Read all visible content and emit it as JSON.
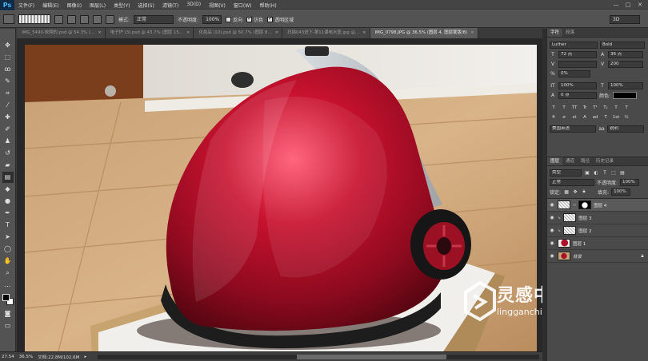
{
  "app": {
    "logo": "Ps"
  },
  "menu": [
    "文件(F)",
    "编辑(E)",
    "图像(I)",
    "图层(L)",
    "类型(Y)",
    "选择(S)",
    "滤镜(T)",
    "3D(D)",
    "视图(V)",
    "窗口(W)",
    "帮助(H)"
  ],
  "window_controls": [
    "—",
    "□",
    "✕"
  ],
  "options": {
    "mode_label": "模式:",
    "mode_value": "正常",
    "opacity_label": "不透明度:",
    "opacity_value": "100%",
    "reverse_label": "反向",
    "dither_label": "仿色",
    "transparency_label": "透明区域",
    "workspace": "3D"
  },
  "tabs": [
    {
      "label": "IMG_5490-依翔的.psd @ 54.3% (...",
      "active": false
    },
    {
      "label": "电子炉 (3).psd @ 43.7% (图层 15...",
      "active": false
    },
    {
      "label": "化妆品 (10).psd @ 50.7% (图层 8...",
      "active": false
    },
    {
      "label": "扫描043进下-第11课电水壶.jpg @...",
      "active": false
    },
    {
      "label": "IMG_0798.JPG @ 36.5% (图层 4, 图层蒙版/8)",
      "active": true
    }
  ],
  "status": {
    "coords": "27.54",
    "zoom": "36.5%",
    "doc": "文档:22.8M/102.6M"
  },
  "character_panel": {
    "tabs": [
      "字符",
      "段落"
    ],
    "font_family": "Luther",
    "font_style": "Bold",
    "font_size": "72 点",
    "leading": "36 点",
    "kerning": "",
    "tracking": "200",
    "scale_pct": "0%",
    "vertical_scale": "100%",
    "horizontal_scale": "100%",
    "baseline": "0 点",
    "color_label": "颜色:",
    "style_buttons": [
      "T",
      "T",
      "TT",
      "Tr",
      "T¹",
      "T₁",
      "T",
      "T"
    ],
    "opentype_buttons": [
      "fi",
      "σ",
      "st",
      "A",
      "ad",
      "T",
      "1st",
      "½"
    ],
    "language": "美国英语",
    "aa_icon": "aa",
    "antialias": "锐利"
  },
  "layers_panel": {
    "tabs": [
      "图层",
      "通道",
      "路径",
      "历史记录"
    ],
    "kind": "类型",
    "blend_mode": "正常",
    "opacity_label": "不透明度:",
    "opacity": "100%",
    "lock_label": "锁定:",
    "fill_label": "填充:",
    "fill": "100%",
    "layers": [
      {
        "name": "图层 4",
        "thumb": "check",
        "mask": true,
        "active": true,
        "italic": false
      },
      {
        "name": "图层 3",
        "thumb": "check",
        "mask": false,
        "active": false,
        "italic": false
      },
      {
        "name": "图层 2",
        "thumb": "check",
        "mask": false,
        "active": false,
        "italic": false
      },
      {
        "name": "图层 1",
        "thumb": "red",
        "mask": false,
        "active": false,
        "italic": false
      },
      {
        "name": "背景",
        "thumb": "bgimg",
        "mask": false,
        "active": false,
        "italic": true
      }
    ]
  },
  "watermark": {
    "title": "灵感中国",
    "url": "lingganchina.com"
  }
}
